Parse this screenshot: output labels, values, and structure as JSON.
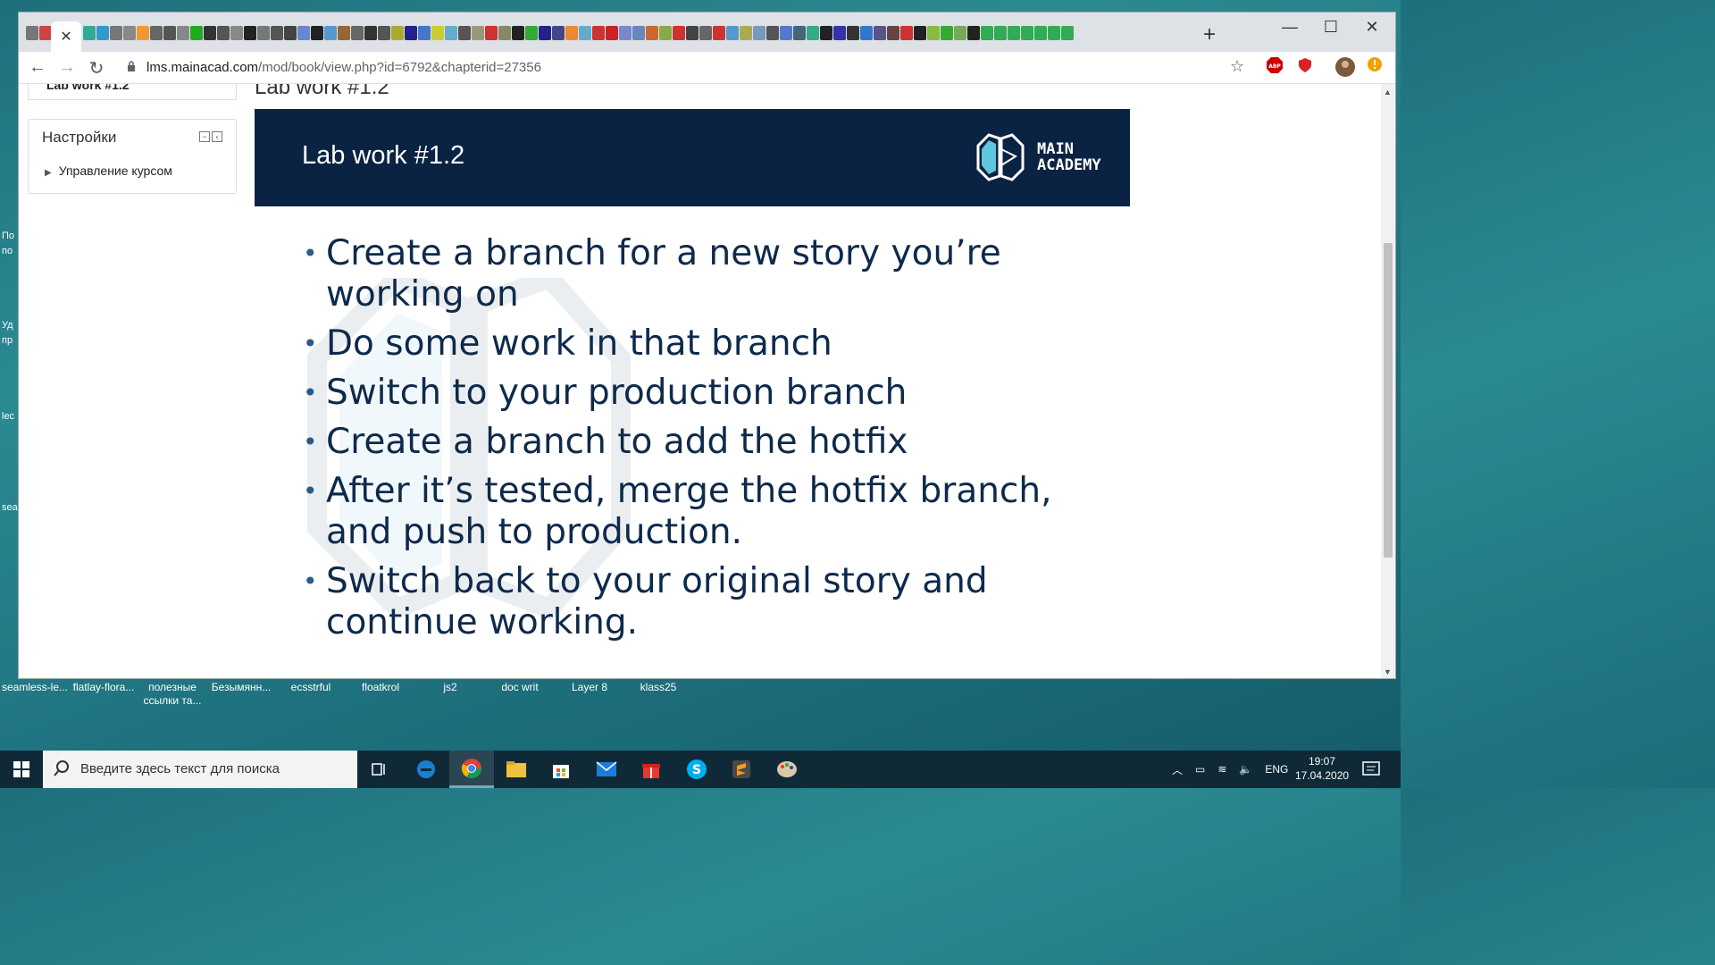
{
  "browser": {
    "url_host": "lms.mainacad.com",
    "url_path": "/mod/book/view.php?id=6792&chapterid=27356",
    "active_tab_close": "✕",
    "new_tab": "+",
    "win_minimize": "—",
    "win_maximize": "☐",
    "win_close": "✕"
  },
  "sidebar": {
    "current_item": "Lab work #1.2",
    "settings_title": "Настройки",
    "settings_item": "Управление курсом"
  },
  "page": {
    "heading": "Lab work #1.2"
  },
  "slide": {
    "title": "Lab work #1.2",
    "logo_line1": "MAIN",
    "logo_line2": "ACADEMY",
    "bullets": [
      "Create a branch for a new story you’re working on",
      "Do some work in that branch",
      "Switch to your production branch",
      "Create a branch to add the hotfix",
      "After it’s tested, merge the hotfix branch, and push to production.",
      "Switch back to your original story and continue working."
    ]
  },
  "desktop": {
    "left_labels": [
      "По",
      "по",
      "Уд",
      "пр",
      "lec",
      "sea"
    ],
    "icons": [
      "seamless-le...",
      "flatlay-flora...",
      "полезные ссылки та...",
      "Безымянн...",
      "ecsstrful",
      "floatkrol",
      "js2",
      "doc writ",
      "Layer 8",
      "klass25"
    ]
  },
  "taskbar": {
    "search_placeholder": "Введите здесь текст для поиска",
    "language": "ENG",
    "time": "19:07",
    "date": "17.04.2020"
  },
  "colors": {
    "slide_header_bg": "#0b2343",
    "bullet_text": "#0e2a4b",
    "taskbar_bg": "#0f2a36"
  }
}
